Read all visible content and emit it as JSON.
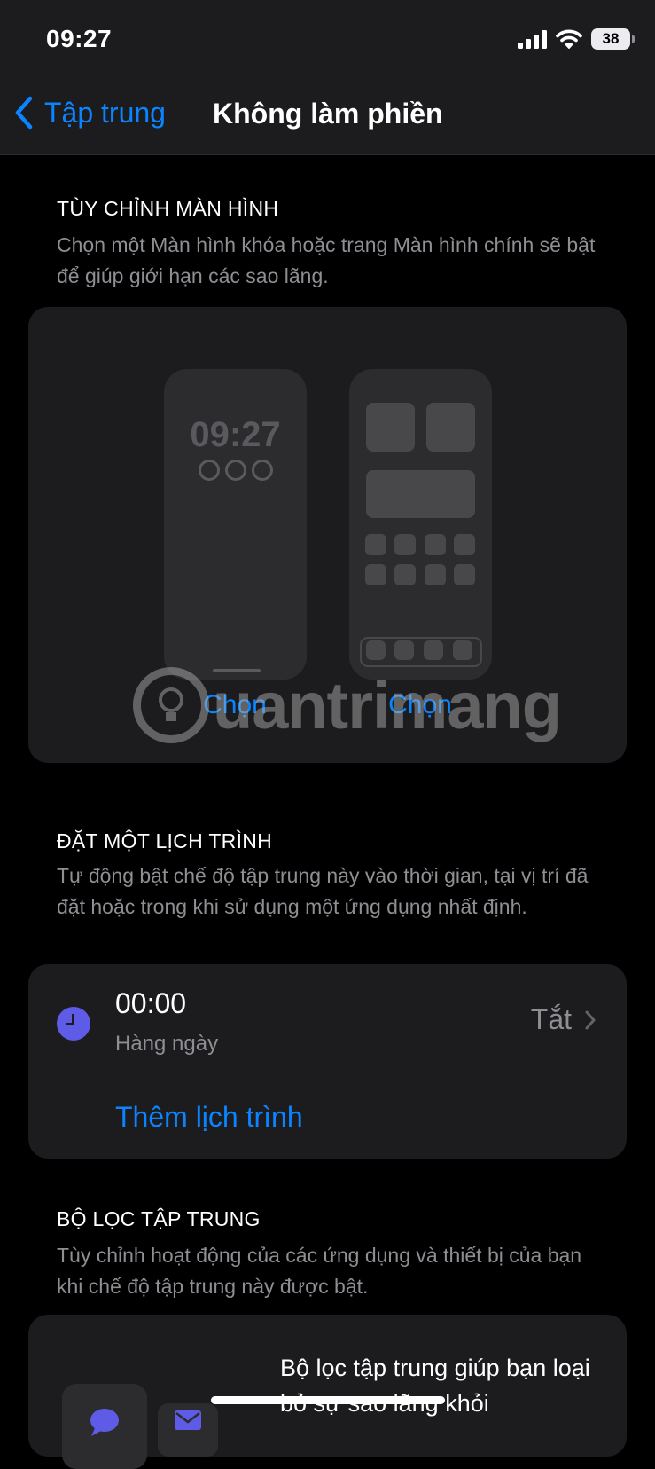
{
  "status_bar": {
    "time": "09:27",
    "battery": "38"
  },
  "nav": {
    "back_label": "Tập trung",
    "title": "Không làm phiền"
  },
  "customize": {
    "header": "TÙY CHỈNH MÀN HÌNH",
    "description": "Chọn một Màn hình khóa hoặc trang Màn hình chính sẽ bật để giúp giới hạn các sao lãng.",
    "lock_preview_time": "09:27",
    "choose_lock_label": "Chọn",
    "choose_home_label": "Chọn"
  },
  "watermark": {
    "text": "uantrimang"
  },
  "schedule": {
    "header": "ĐẶT MỘT LỊCH TRÌNH",
    "description": "Tự động bật chế độ tập trung này vào thời gian, tại vị trí đã đặt hoặc trong khi sử dụng một ứng dụng nhất định.",
    "items": [
      {
        "time": "00:00",
        "repeat": "Hàng ngày",
        "status": "Tắt"
      }
    ],
    "add_label": "Thêm lịch trình"
  },
  "filters": {
    "header": "BỘ LỌC TẬP TRUNG",
    "description": "Tùy chỉnh hoạt động của các ứng dụng và thiết bị của bạn khi chế độ tập trung này được bật.",
    "card_text": "Bộ lọc tập trung giúp bạn loại bỏ sự sao lãng khỏi"
  },
  "colors": {
    "accent": "#0a84ff",
    "clock_icon": "#5e5ce6",
    "card_bg": "#1c1c1e"
  }
}
